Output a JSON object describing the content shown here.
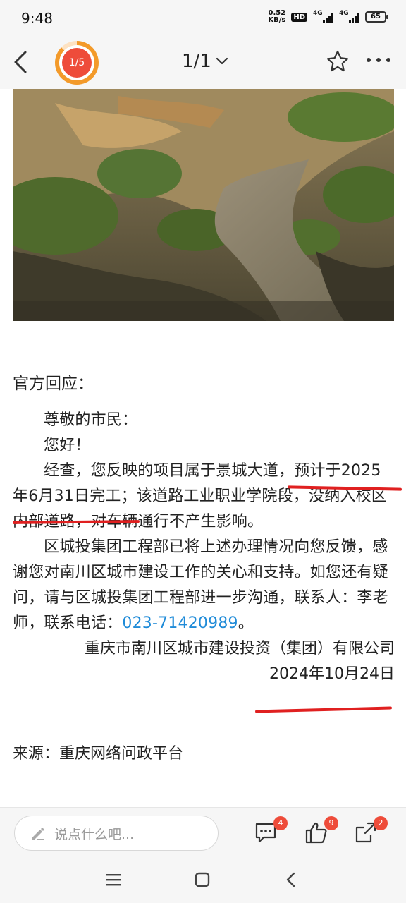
{
  "status_bar": {
    "time": "9:48",
    "net_speed_value": "0.52",
    "net_speed_unit": "KB/s",
    "hd_label": "HD",
    "sig1_label": "4G",
    "sig2_label": "4G",
    "battery": "65"
  },
  "nav": {
    "avatar_progress": "1/5",
    "page_indicator": "1/1"
  },
  "article": {
    "section_title": "官方回应：",
    "greeting": "尊敬的市民：",
    "hello": "您好！",
    "para1_part1": "经查，您反映的项目属于景城大道，",
    "para1_part2": "预计于2025年6月31日完工",
    "para1_part3": "；该道路工业职业学院段，没纳入校区内部道路，对车辆通行不产生影响。",
    "para2": "区城投集团工程部已将上述办理情况向您反馈，感谢您对南川区城市建设工作的关心和支持。如您还有疑问，请与区城投集团工程部进一步沟通，联系人：李老师，联系电话：",
    "phone": "023-71420989",
    "para2_end": "。",
    "org": "重庆市南川区城市建设投资（集团）有限公司",
    "date": "2024年10月24日",
    "source": "来源：重庆网络问政平台"
  },
  "comment_bar": {
    "placeholder": "说点什么吧...",
    "comment_count": "4",
    "like_count": "9",
    "share_count": "2"
  },
  "colors": {
    "accent_red": "#e02020",
    "link_blue": "#1f8bd8",
    "badge_red": "#ee4c3a",
    "ring_orange": "#f39a2a"
  }
}
